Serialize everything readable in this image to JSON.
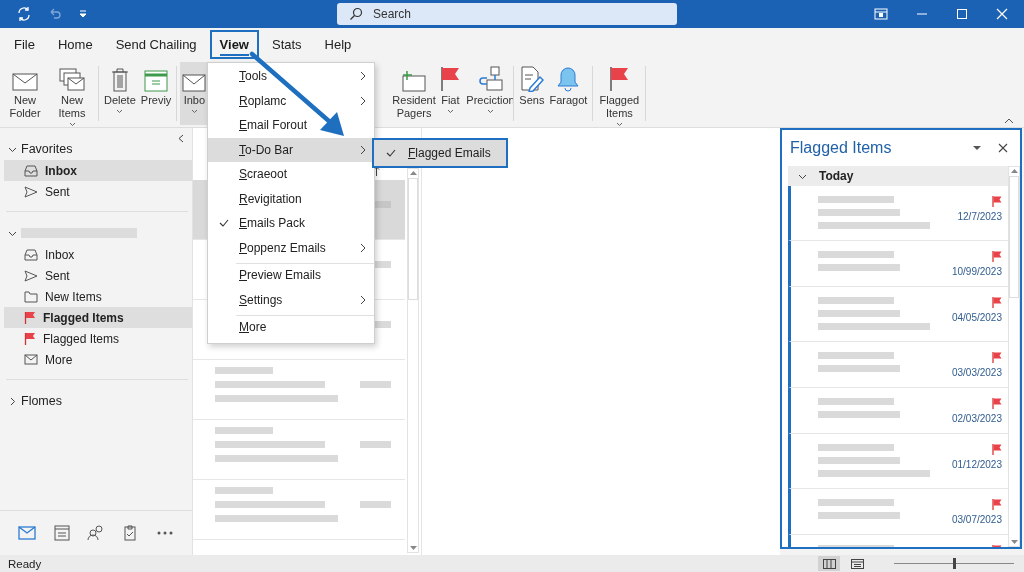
{
  "title_bar": {
    "search": {
      "placeholder": "Search"
    }
  },
  "tabs": [
    {
      "label": "File",
      "selected": false
    },
    {
      "label": "Home",
      "selected": false
    },
    {
      "label": "Send Chailing",
      "selected": false
    },
    {
      "label": "View",
      "selected": true
    },
    {
      "label": "Stats",
      "selected": false
    },
    {
      "label": "Help",
      "selected": false
    }
  ],
  "ribbon": {
    "groups": [
      {
        "buttons": [
          {
            "label": "New Folder",
            "dropdown": false,
            "selected": false
          },
          {
            "label": "New Items",
            "dropdown": true,
            "selected": false
          }
        ]
      },
      {
        "buttons": [
          {
            "label": "Delete",
            "dropdown": true,
            "selected": false
          },
          {
            "label": "Previy",
            "dropdown": false,
            "selected": false
          }
        ]
      },
      {
        "buttons": [
          {
            "label": "Inbo",
            "dropdown": true,
            "selected": true
          }
        ]
      },
      {
        "buttons": [
          {
            "label": "Resident Pagers",
            "dropdown": false,
            "selected": false
          },
          {
            "label": "Fiat",
            "dropdown": true,
            "selected": false
          },
          {
            "label": "Preciction",
            "dropdown": true,
            "selected": false
          }
        ]
      },
      {
        "buttons": [
          {
            "label": "Sens",
            "dropdown": false,
            "selected": false
          },
          {
            "label": "Faragot",
            "dropdown": false,
            "selected": false
          }
        ]
      },
      {
        "buttons": [
          {
            "label": "Flagged Items",
            "dropdown": true,
            "selected": false
          }
        ]
      }
    ]
  },
  "view_menu": {
    "items": [
      {
        "label": "Tools",
        "submenu": true,
        "checked": false,
        "selected": false,
        "separator_before": false
      },
      {
        "label": "Roplamc",
        "submenu": true,
        "checked": false,
        "selected": false,
        "separator_before": false
      },
      {
        "label": "Email Forout",
        "submenu": false,
        "checked": false,
        "selected": false,
        "separator_before": false
      },
      {
        "label": "To-Do Bar",
        "submenu": true,
        "checked": false,
        "selected": true,
        "separator_before": false
      },
      {
        "label": "Scraeoot",
        "submenu": false,
        "checked": false,
        "selected": false,
        "separator_before": false
      },
      {
        "label": "Revigitation",
        "submenu": false,
        "checked": false,
        "selected": false,
        "separator_before": false
      },
      {
        "label": "Emails Pack",
        "submenu": false,
        "checked": true,
        "selected": false,
        "separator_before": false
      },
      {
        "label": "Poppenz Emails",
        "submenu": true,
        "checked": false,
        "selected": false,
        "separator_before": false
      },
      {
        "label": "Preview Emails",
        "submenu": false,
        "checked": false,
        "selected": false,
        "separator_before": true
      },
      {
        "label": "Settings",
        "submenu": true,
        "checked": false,
        "selected": false,
        "separator_before": false
      },
      {
        "label": "More",
        "submenu": false,
        "checked": false,
        "selected": false,
        "separator_before": true
      }
    ],
    "submenu": {
      "items": [
        {
          "label": "Flagged Emails",
          "checked": true,
          "selected": true
        }
      ]
    }
  },
  "nav": {
    "sections": [
      {
        "label": "Favorites",
        "expanded": true,
        "items": [
          {
            "label": "Inbox",
            "selected": true
          },
          {
            "label": "Sent",
            "selected": false
          }
        ]
      },
      {
        "expanded": true,
        "items": [
          {
            "label": "Inbox",
            "selected": false
          },
          {
            "label": "Sent",
            "selected": false
          },
          {
            "label": "New Items",
            "selected": false
          },
          {
            "label": "Flagged Items",
            "selected": true
          },
          {
            "label": "Flagged Items",
            "selected": false
          },
          {
            "label": "More",
            "selected": false
          }
        ]
      },
      {
        "label": "Flomes",
        "expanded": false
      }
    ],
    "modules": [
      {
        "selected": true
      },
      {
        "selected": false
      },
      {
        "selected": false
      },
      {
        "selected": false
      },
      {
        "selected": false
      }
    ]
  },
  "message_list": {
    "items": [
      {
        "selected": true
      },
      {
        "selected": false
      },
      {
        "selected": false
      },
      {
        "selected": false
      },
      {
        "selected": false
      },
      {
        "selected": false
      }
    ]
  },
  "flagged_pane": {
    "title": "Flagged Items",
    "group": {
      "label": "Today",
      "expanded": true
    },
    "items": [
      {
        "date": "12/7/2023",
        "kind": "long"
      },
      {
        "date": "10/99/2023",
        "kind": "short"
      },
      {
        "date": "04/05/2023",
        "kind": "long"
      },
      {
        "date": "03/03/2023",
        "kind": "short"
      },
      {
        "date": "02/03/2023",
        "kind": "short"
      },
      {
        "date": "01/12/2023",
        "kind": "long"
      },
      {
        "date": "03/07/2023",
        "kind": "short"
      },
      {
        "kind": "short"
      }
    ]
  },
  "status_bar": {
    "text": "Ready",
    "views": [
      {
        "selected": true
      },
      {
        "selected": false
      }
    ],
    "zoom": {
      "level": 0.5
    }
  }
}
